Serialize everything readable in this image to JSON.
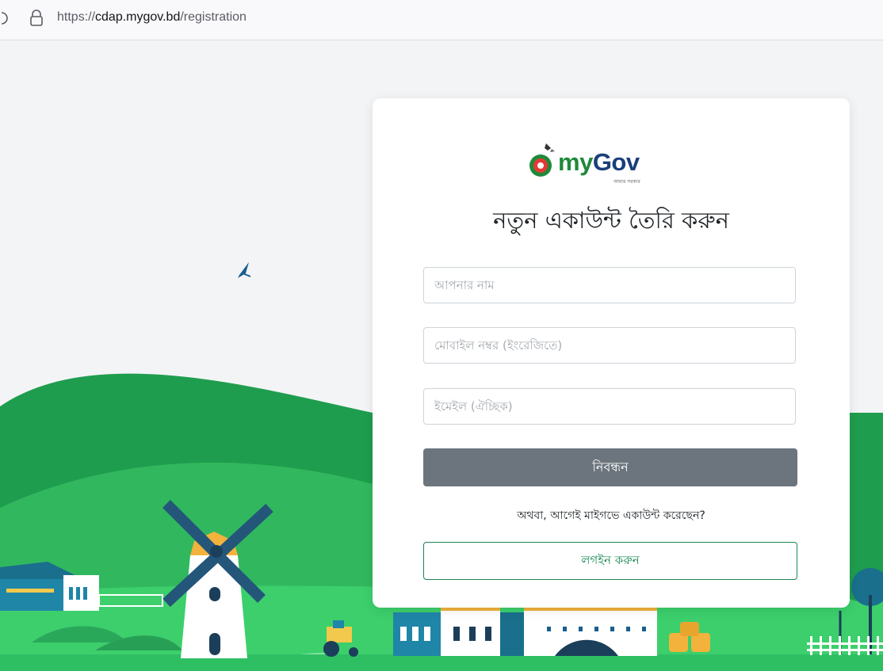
{
  "browser": {
    "url_prefix": "https://",
    "url_host": "cdap.mygov.bd",
    "url_path": "/registration"
  },
  "logo": {
    "brand_part1": "my",
    "brand_part2": "Gov",
    "tagline": "আমার সরকার"
  },
  "form": {
    "title": "নতুন একাউন্ট তৈরি করুন",
    "name_placeholder": "আপনার নাম",
    "mobile_placeholder": "মোবাইল নম্বর (ইংরেজিতে)",
    "email_placeholder": "ইমেইল (ঐচ্ছিক)",
    "register_label": "নিবন্ধন",
    "alt_text": "অথবা, আগেই মাইগভে একাউন্ট করেছেন?",
    "login_label": "লগইন করুন"
  },
  "colors": {
    "page_bg": "#f3f4f6",
    "register_button": "#6c757d",
    "login_accent": "#198754",
    "hill_dark": "#1f9d4e",
    "hill_light": "#4cd37a"
  },
  "icons": {
    "reload": "reload-icon",
    "lock": "lock-icon",
    "bird": "bird-icon",
    "windmill": "windmill-icon",
    "tractor": "tractor-icon"
  }
}
